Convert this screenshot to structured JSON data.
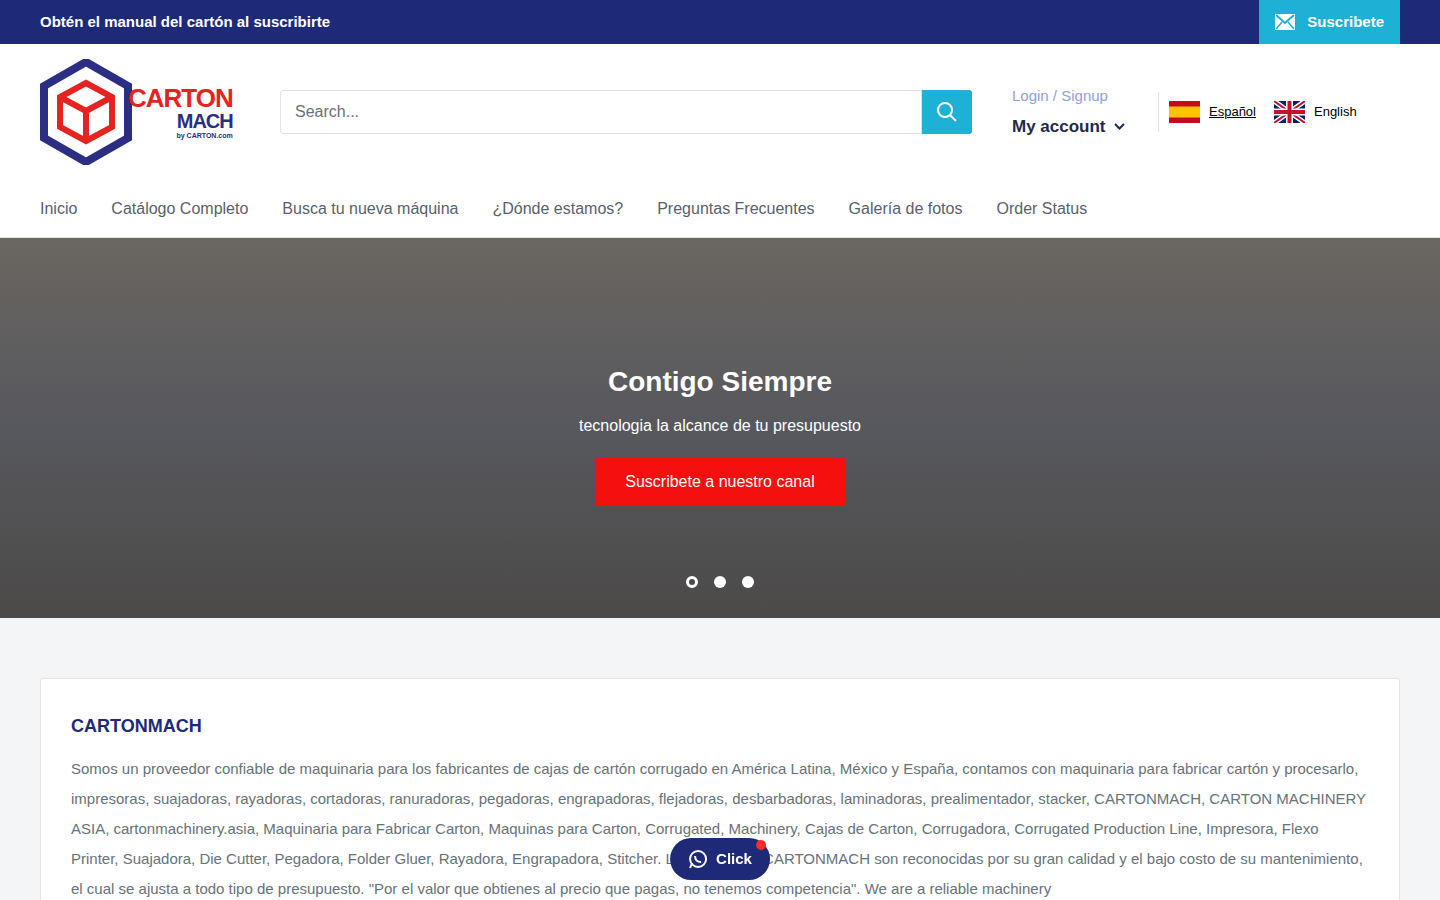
{
  "announcement": {
    "text": "Obtén el manual del cartón al suscribirte",
    "button": "Suscribete"
  },
  "logo": {
    "line1": "CARTON",
    "line2": "MACH",
    "byline": "by CARTON.com"
  },
  "search": {
    "placeholder": "Search..."
  },
  "account": {
    "login": "Login / Signup",
    "label": "My account"
  },
  "languages": [
    {
      "label": "Español",
      "kind": "es",
      "selected": true
    },
    {
      "label": "English",
      "kind": "gb",
      "selected": false
    }
  ],
  "nav": [
    "Inicio",
    "Catálogo Completo",
    "Busca tu nueva máquina",
    "¿Dónde estamos?",
    "Preguntas Frecuentes",
    "Galería de fotos",
    "Order Status"
  ],
  "hero": {
    "title": "Contigo Siempre",
    "subtitle": "tecnologia la alcance de tu presupuesto",
    "button": "Suscribete a nuestro canal",
    "slides": [
      {
        "selected": true
      },
      {
        "selected": false
      },
      {
        "selected": false
      }
    ]
  },
  "about": {
    "title": "CARTONMACH",
    "text": "Somos un proveedor confiable de maquinaria para los fabricantes de cajas de cartón corrugado en América Latina, México y España, contamos con maquinaria para fabricar cartón y procesarlo, impresoras, suajadoras, rayadoras, cortadoras, ranuradoras, pegadoras, engrapadoras, flejadoras, desbarbadoras, laminadoras, prealimentador, stacker, CARTONMACH, CARTON MACHINERY ASIA, cartonmachinery.asia, Maquinaria para Fabricar Carton, Maquinas para Carton, Corrugated, Machinery, Cajas de Carton, Corrugadora, Corrugated Production Line, Impresora, Flexo Printer, Suajadora, Die Cutter, Pegadora, Folder Gluer, Rayadora, Engrapadora, Stitcher. Las máquinas CARTONMACH son reconocidas por su gran calidad y el bajo costo de su mantenimiento, el cual se ajusta a todo tipo de presupuesto. \"Por el valor que obtienes al precio que pagas, no tenemos competencia\". We are a reliable machinery"
  },
  "chat": {
    "label": "Click",
    "unread": true
  }
}
